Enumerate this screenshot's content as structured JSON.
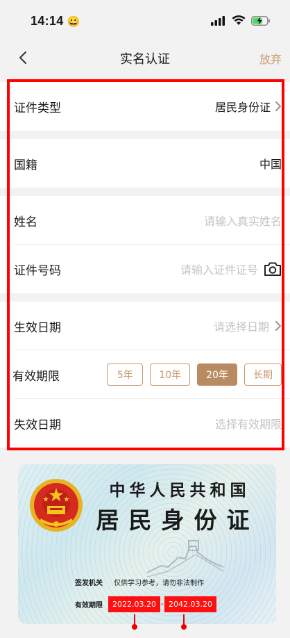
{
  "status_bar": {
    "time": "14:14",
    "time_emoji": "😀"
  },
  "nav": {
    "title": "实名认证",
    "action": "放弃"
  },
  "form": {
    "cert_type": {
      "label": "证件类型",
      "value": "居民身份证"
    },
    "nationality": {
      "label": "国籍",
      "value": "中国"
    },
    "name": {
      "label": "姓名",
      "placeholder": "请输入真实姓名"
    },
    "cert_number": {
      "label": "证件号码",
      "placeholder": "请输入证件证号"
    },
    "effective_date": {
      "label": "生效日期",
      "placeholder": "请选择日期"
    },
    "validity": {
      "label": "有效期限",
      "options": [
        "5年",
        "10年",
        "20年",
        "长期"
      ],
      "selected": "20年"
    },
    "expiry_date": {
      "label": "失效日期",
      "placeholder": "选择有效期限"
    }
  },
  "id_card": {
    "title_line1": "中华人民共和国",
    "title_line2": "居民身份证",
    "issuer_label": "签发机关",
    "issuer_value": "仅供学习参考，请勿非法制作",
    "validity_label": "有效期限",
    "valid_from": "2022.03.20",
    "valid_separator": "-",
    "valid_to": "2042.03.20"
  },
  "colors": {
    "accent": "#c8996a",
    "accent_selected": "#b98b62",
    "highlight_frame": "#ff0000",
    "date_box": "#ff1010",
    "placeholder": "#c4c4c4"
  }
}
